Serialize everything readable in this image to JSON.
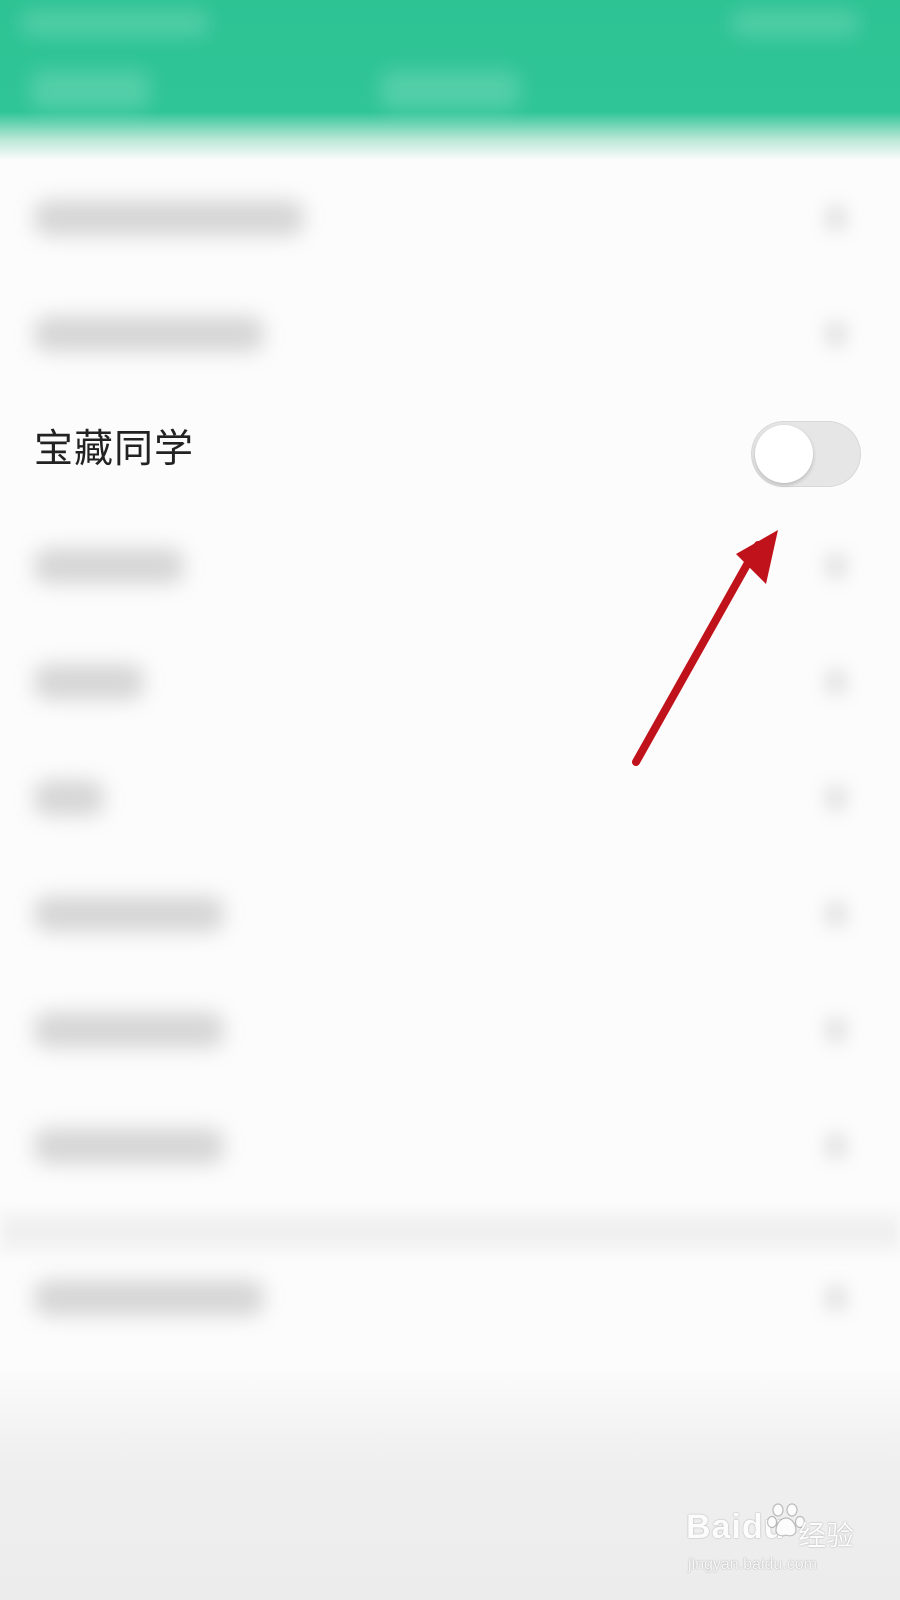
{
  "header": {
    "status_placeholder": "",
    "title_placeholder": ""
  },
  "settings": {
    "visible_row": {
      "label": "宝藏同学",
      "toggle": {
        "state": "off"
      }
    }
  },
  "watermark": {
    "brand": "Bai",
    "brand_suffix": "du",
    "service": "经验",
    "url": "jingyan.baidu.com",
    "icon": "paw-icon"
  },
  "colors": {
    "header": "#2fc596",
    "arrow": "#c0121a",
    "toggle_off": "#e6e6e6",
    "knob": "#ffffff"
  }
}
